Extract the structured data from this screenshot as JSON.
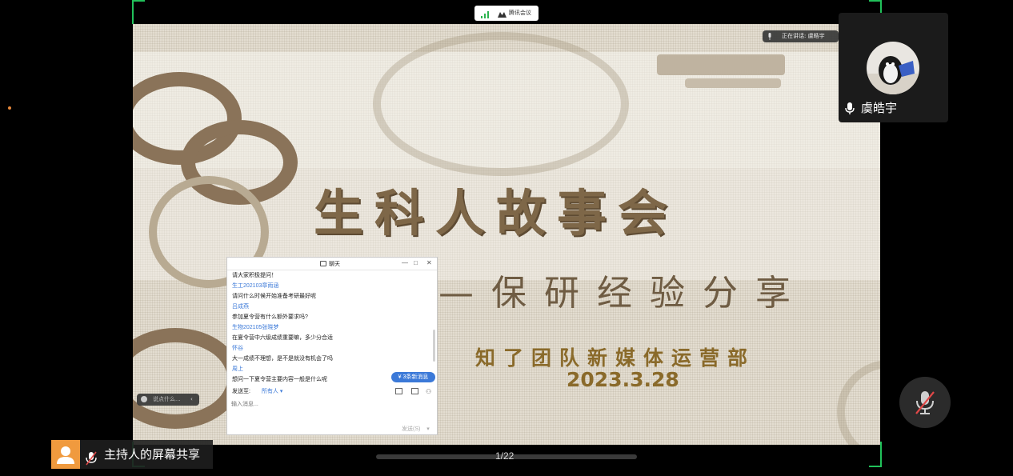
{
  "meeting": {
    "app_name": "腾讯会议",
    "speaking_label": "正在讲话: 虞皓宇",
    "participant_name": "虞皓宇",
    "screen_share_label": "主持人的屏幕共享",
    "page_indicator": "1/22"
  },
  "slide": {
    "title": "生科人故事会",
    "subtitle": "—保研经验分享",
    "org": "知了团队新媒体运营部",
    "date": "2023.3.28"
  },
  "chat": {
    "window_title": "聊天",
    "messages": [
      {
        "text": "请大家积极提问！",
        "is_sender": false
      },
      {
        "text": "生工202103章雨涵",
        "is_sender": true
      },
      {
        "text": "请问什么时候开始准备考研最好呢",
        "is_sender": false
      },
      {
        "text": "吕成燕",
        "is_sender": true
      },
      {
        "text": "参加夏令营有什么额外要求吗?",
        "is_sender": false
      },
      {
        "text": "生物202105张晓梦",
        "is_sender": true
      },
      {
        "text": "在夏令营中六级成绩重要嘛，多少分合适",
        "is_sender": false
      },
      {
        "text": "怀谷",
        "is_sender": true
      },
      {
        "text": "大一成绩不理想，是不是就没有机会了吗",
        "is_sender": false
      },
      {
        "text": "周上",
        "is_sender": true
      },
      {
        "text": "想问一下夏令营主要内容一般是什么呢",
        "is_sender": false
      }
    ],
    "new_messages_badge": "3条新消息",
    "send_to_label": "发送至:",
    "send_to_value": "所有人",
    "input_placeholder": "输入消息...",
    "send_button": "发送(S)"
  },
  "overlay": {
    "say_something": "说点什么..."
  },
  "colors": {
    "frame_green": "#21c15a",
    "accent_blue": "#3b79d8",
    "slide_brown": "#7e6748"
  }
}
